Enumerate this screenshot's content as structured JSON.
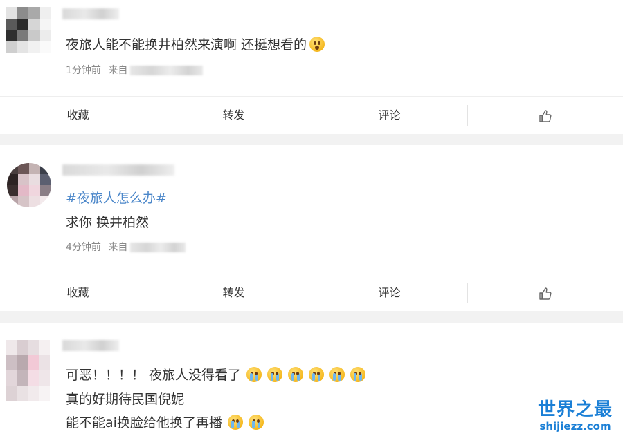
{
  "posts": [
    {
      "text": "夜旅人能不能换井柏然来演啊 还挺想看的",
      "meta_time": "1分钟前",
      "meta_from": "来自",
      "emoji": "shocked-face-icon"
    },
    {
      "topic": "#夜旅人怎么办#",
      "text": "求你 换井柏然",
      "meta_time": "4分钟前",
      "meta_from": "来自"
    },
    {
      "line1": "可恶！！！！ 夜旅人没得看了",
      "line2": "真的好期待民国倪妮",
      "line3": "能不能ai换脸给他换了再播",
      "emoji": "crying-face-icon"
    }
  ],
  "actions": {
    "collect": "收藏",
    "repost": "转发",
    "comment": "评论",
    "like": "like-icon"
  },
  "watermark": {
    "title": "世界之最",
    "url": "shijiezz.com"
  },
  "colors": {
    "topic": "#4a86c9",
    "meta": "#888888",
    "separator": "#f2f2f2",
    "watermark": "#1a7fd6"
  }
}
